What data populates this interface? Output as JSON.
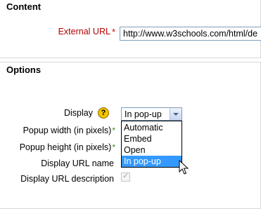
{
  "content_section": {
    "title": "Content",
    "external_url_label": "External URL",
    "required_marker": "*",
    "url_value": "http://www.w3schools.com/html/de"
  },
  "options_section": {
    "title": "Options",
    "display_label": "Display",
    "help_icon": "?",
    "select_value": "In pop-up",
    "options": [
      "Automatic",
      "Embed",
      "Open",
      "In pop-up"
    ],
    "selected_option": "In pop-up",
    "popup_width_label": "Popup width (in pixels)",
    "popup_height_label": "Popup height (in pixels)",
    "required_marker": "*",
    "display_url_name_label": "Display URL name",
    "display_url_description_label": "Display URL description",
    "display_url_description_checked": true
  },
  "colors": {
    "required_red": "#cc0000",
    "required_green": "#3a8a1e",
    "highlight": "#3399ff",
    "help_icon": "#f2c200"
  }
}
